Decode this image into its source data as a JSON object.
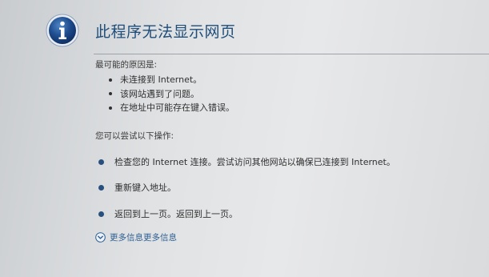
{
  "page": {
    "title": "此程序无法显示网页"
  },
  "causes": {
    "heading": "最可能的原因是:",
    "items": [
      "未连接到 Internet。",
      "该网站遇到了问题。",
      "在地址中可能存在键入错误。"
    ]
  },
  "actions": {
    "heading": "您可以尝试以下操作:",
    "items": [
      "检查您的 Internet 连接。尝试访问其他网站以确保已连接到 Internet。",
      "重新键入地址。",
      "返回到上一页。返回到上一页。"
    ]
  },
  "more_info": {
    "label": "更多信息更多信息"
  },
  "icons": {
    "info": "info-icon",
    "expand": "chevron-down-circle-icon"
  },
  "colors": {
    "title": "#1f4e7a",
    "info_icon": "#1e4c8e",
    "link": "#2f5f94",
    "action_bullet": "#27507e"
  }
}
